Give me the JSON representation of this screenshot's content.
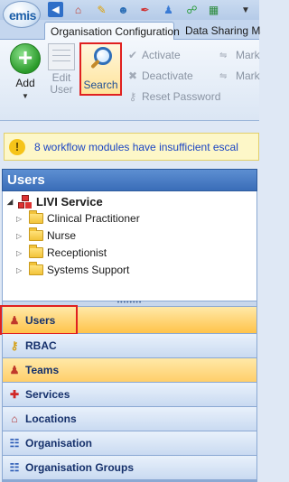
{
  "app": {
    "logo_text": "emis",
    "quick_access": [
      "back-arrow-icon",
      "home-icon",
      "pencil-icon",
      "user-search-icon",
      "pen-icon",
      "user-icon",
      "workflow-icon",
      "grid-icon",
      "dropdown-icon"
    ]
  },
  "tabs": [
    {
      "label": "Organisation Configuration",
      "active": true
    },
    {
      "label": "Data Sharing Ma",
      "active": false
    }
  ],
  "ribbon": {
    "add_label": "Add",
    "edit_user_label": "Edit User",
    "search_label": "Search",
    "activate_label": "Activate",
    "deactivate_label": "Deactivate",
    "reset_password_label": "Reset Password",
    "mark_label_1": "Mark",
    "mark_label_2": "Mark"
  },
  "alert": {
    "text": "8 workflow modules have insufficient escal"
  },
  "users_panel": {
    "title": "Users",
    "root": "LIVI Service",
    "items": [
      "Clinical Practitioner",
      "Nurse",
      "Receptionist",
      "Systems Support"
    ]
  },
  "nav": {
    "items": [
      {
        "label": "Users",
        "selected": true
      },
      {
        "label": "RBAC"
      },
      {
        "label": "Teams"
      },
      {
        "label": "Services"
      },
      {
        "label": "Locations"
      },
      {
        "label": "Organisation"
      },
      {
        "label": "Organisation Groups"
      }
    ]
  },
  "colors": {
    "highlight_box": "#e02020",
    "selected_nav": "#ffc34a",
    "alert_text": "#1b45c4"
  }
}
